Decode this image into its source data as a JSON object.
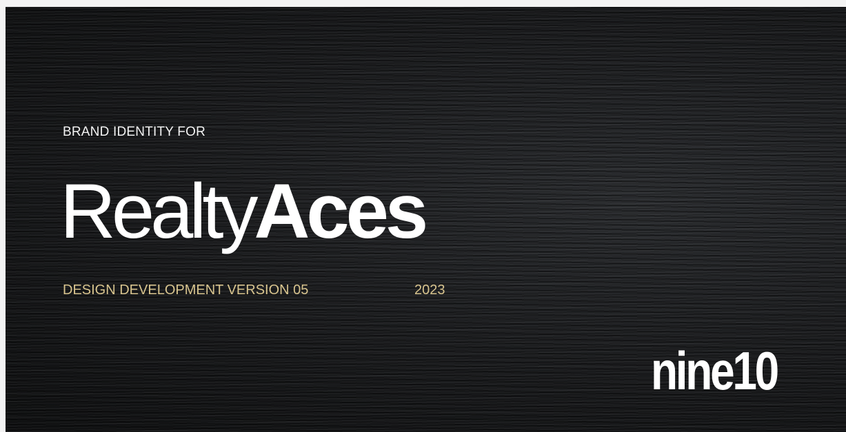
{
  "eyebrow": "BRAND IDENTITY FOR",
  "title": {
    "light": "Realty",
    "bold": "Aces"
  },
  "subtitle": "DESIGN DEVELOPMENT VERSION 05",
  "year": "2023",
  "logo": "nine10",
  "colors": {
    "background": "#141516",
    "accent": "#d8c48e",
    "text": "#ffffff"
  }
}
